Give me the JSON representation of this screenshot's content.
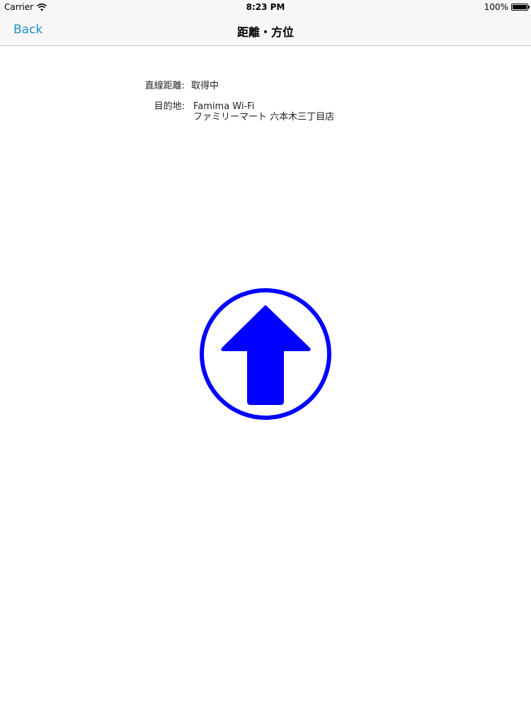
{
  "status_bar": {
    "carrier": "Carrier",
    "time": "8:23 PM",
    "battery": "100%"
  },
  "nav": {
    "back_label": "Back",
    "title": "距離・方位"
  },
  "info": {
    "distance_label": "直線距離:",
    "distance_value": "取得中",
    "destination_label": "目的地:",
    "destination_name": "Famima Wi-Fi",
    "destination_place": "ファミリーマート 六本木三丁目店"
  },
  "compass": {
    "icon": "up-arrow-icon",
    "color": "#0000ff"
  },
  "colors": {
    "accent": "#1e90c8",
    "arrow": "#0000ff"
  }
}
